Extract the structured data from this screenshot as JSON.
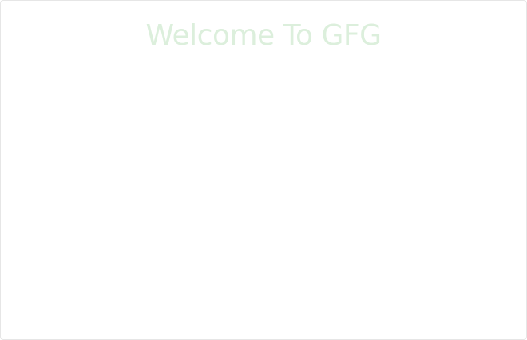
{
  "page": {
    "title": "Welcome To GFG"
  },
  "colors": {
    "title_text": "#dcefdc",
    "frame_border": "#e6e6e6",
    "background": "#ffffff"
  }
}
